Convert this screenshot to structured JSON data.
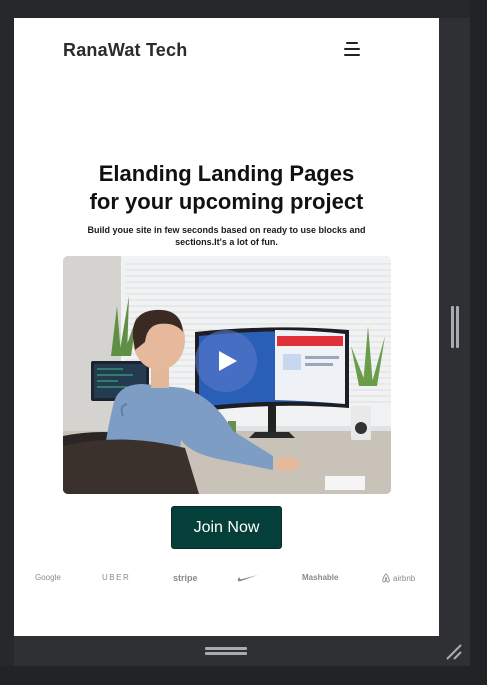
{
  "header": {
    "brand": "RanaWat Tech",
    "menu_icon": "hamburger-menu-icon"
  },
  "hero": {
    "headline_line1": "Elanding Landing Pages",
    "headline_line2": "for your upcoming project",
    "subtext_line1": "Build youe site in few seconds based on ready to use blocks and",
    "subtext_line2": "sections.It's a lot of fun.",
    "video_thumbnail": "man-at-desk-with-monitors-photo",
    "play_icon": "play-icon"
  },
  "cta": {
    "join_label": "Join Now",
    "bg_color": "#053f3a"
  },
  "logos": [
    {
      "name": "Google",
      "label": "Google"
    },
    {
      "name": "Uber",
      "label": "UBER"
    },
    {
      "name": "Stripe",
      "label": "stripe"
    },
    {
      "name": "Nike",
      "icon": "nike-swoosh-icon"
    },
    {
      "name": "Mashable",
      "label": "Mashable"
    },
    {
      "name": "Airbnb",
      "label": "airbnb",
      "icon": "airbnb-icon"
    }
  ],
  "colors": {
    "frame_bg": "#27282b",
    "page_bg": "#ffffff",
    "accent": "#053f3a"
  }
}
